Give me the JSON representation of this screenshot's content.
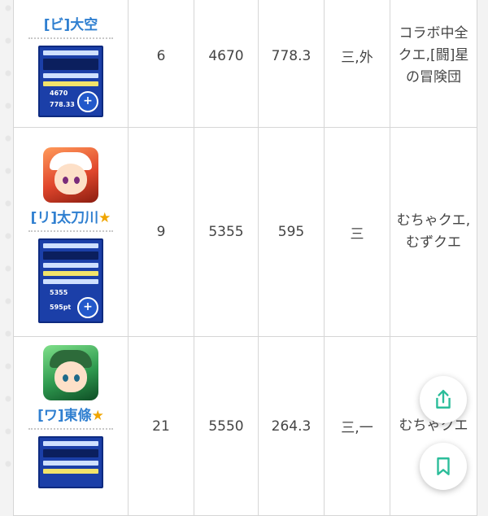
{
  "rows": [
    {
      "name": "[ビ]大空",
      "has_star": false,
      "star": "",
      "level": "6",
      "power": "4670",
      "value": "778.3",
      "position": "三,外",
      "note": "コラボ中全クエ,[闘]星の冒険団",
      "thumb_nums": [
        "4670",
        "778.33"
      ]
    },
    {
      "name": "[リ]太刀川",
      "has_star": true,
      "star": "★",
      "level": "9",
      "power": "5355",
      "value": "595",
      "position": "三",
      "note": "むちゃクエ,むずクエ",
      "thumb_nums": [
        "5355",
        "595pt"
      ]
    },
    {
      "name": "[ワ]東條",
      "has_star": true,
      "star": "★",
      "level": "21",
      "power": "5550",
      "value": "264.3",
      "position": "三,一",
      "note": "むちゃクエ",
      "thumb_nums": [
        "",
        ""
      ]
    }
  ],
  "actions": {
    "share_icon": "share-icon",
    "bookmark_icon": "bookmark-icon",
    "zoom_icon": "zoom-in-icon"
  },
  "colors": {
    "link": "#2f7fd0",
    "star": "#f0a500",
    "fab_icon": "#2bbd9a",
    "thumb_bg": "#1b3fa8"
  }
}
